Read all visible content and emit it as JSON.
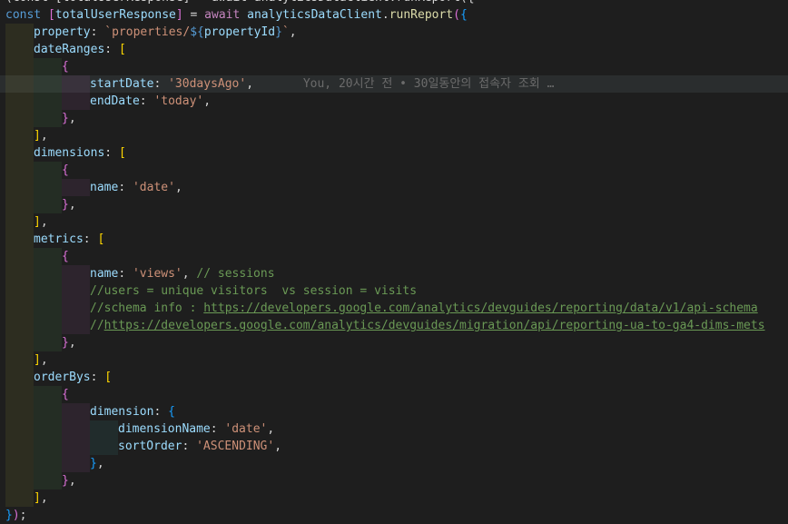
{
  "editor": {
    "colors": {
      "background": "#1e1e1e",
      "keyword": "#569cd6",
      "control": "#c586c0",
      "variable": "#9cdcfe",
      "function": "#dcdcaa",
      "string": "#ce9178",
      "comment": "#6a9955",
      "bracket_gold": "#ffd700",
      "bracket_orchid": "#da70d6",
      "bracket_blue": "#179fff"
    },
    "lines": [
      {
        "indent": 0,
        "tokens": [
          {
            "t": "(const [totalUserResponse] = await analyticsDataClient.runReport({",
            "c": "tk-p"
          }
        ]
      },
      {
        "indent": 0,
        "tokens": [
          {
            "t": "const ",
            "c": "tk-kw"
          },
          {
            "t": "[",
            "c": "tk-b2"
          },
          {
            "t": "totalUserResponse",
            "c": "tk-var"
          },
          {
            "t": "]",
            "c": "tk-b2"
          },
          {
            "t": " = ",
            "c": "tk-p"
          },
          {
            "t": "await ",
            "c": "tk-kw2"
          },
          {
            "t": "analyticsDataClient",
            "c": "tk-var"
          },
          {
            "t": ".",
            "c": "tk-p"
          },
          {
            "t": "runReport",
            "c": "tk-fn"
          },
          {
            "t": "(",
            "c": "tk-b2"
          },
          {
            "t": "{",
            "c": "tk-b3"
          }
        ]
      },
      {
        "indent": 1,
        "tokens": [
          {
            "t": "property",
            "c": "tk-var"
          },
          {
            "t": ": ",
            "c": "tk-p"
          },
          {
            "t": "`properties/",
            "c": "tk-str"
          },
          {
            "t": "${",
            "c": "tk-kw"
          },
          {
            "t": "propertyId",
            "c": "tk-var"
          },
          {
            "t": "}",
            "c": "tk-kw"
          },
          {
            "t": "`",
            "c": "tk-str"
          },
          {
            "t": ",",
            "c": "tk-p"
          }
        ]
      },
      {
        "indent": 1,
        "tokens": [
          {
            "t": "dateRanges",
            "c": "tk-var"
          },
          {
            "t": ": ",
            "c": "tk-p"
          },
          {
            "t": "[",
            "c": "tk-b1"
          }
        ]
      },
      {
        "indent": 2,
        "tokens": [
          {
            "t": "{",
            "c": "tk-b2"
          }
        ]
      },
      {
        "indent": 3,
        "current": true,
        "tokens": [
          {
            "t": "startDate",
            "c": "tk-var"
          },
          {
            "t": ": ",
            "c": "tk-p"
          },
          {
            "t": "'30daysAgo'",
            "c": "tk-str"
          },
          {
            "t": ",",
            "c": "tk-p"
          },
          {
            "t": "       You, 20시간 전 • 30일동안의 접속자 조회 …",
            "c": "ghost"
          }
        ]
      },
      {
        "indent": 3,
        "tokens": [
          {
            "t": "endDate",
            "c": "tk-var"
          },
          {
            "t": ": ",
            "c": "tk-p"
          },
          {
            "t": "'today'",
            "c": "tk-str"
          },
          {
            "t": ",",
            "c": "tk-p"
          }
        ]
      },
      {
        "indent": 2,
        "tokens": [
          {
            "t": "}",
            "c": "tk-b2"
          },
          {
            "t": ",",
            "c": "tk-p"
          }
        ]
      },
      {
        "indent": 1,
        "tokens": [
          {
            "t": "]",
            "c": "tk-b1"
          },
          {
            "t": ",",
            "c": "tk-p"
          }
        ]
      },
      {
        "indent": 1,
        "tokens": [
          {
            "t": "dimensions",
            "c": "tk-var"
          },
          {
            "t": ": ",
            "c": "tk-p"
          },
          {
            "t": "[",
            "c": "tk-b1"
          }
        ]
      },
      {
        "indent": 2,
        "tokens": [
          {
            "t": "{",
            "c": "tk-b2"
          }
        ]
      },
      {
        "indent": 3,
        "tokens": [
          {
            "t": "name",
            "c": "tk-var"
          },
          {
            "t": ": ",
            "c": "tk-p"
          },
          {
            "t": "'date'",
            "c": "tk-str"
          },
          {
            "t": ",",
            "c": "tk-p"
          }
        ]
      },
      {
        "indent": 2,
        "tokens": [
          {
            "t": "}",
            "c": "tk-b2"
          },
          {
            "t": ",",
            "c": "tk-p"
          }
        ]
      },
      {
        "indent": 1,
        "tokens": [
          {
            "t": "]",
            "c": "tk-b1"
          },
          {
            "t": ",",
            "c": "tk-p"
          }
        ]
      },
      {
        "indent": 1,
        "tokens": [
          {
            "t": "metrics",
            "c": "tk-var"
          },
          {
            "t": ": ",
            "c": "tk-p"
          },
          {
            "t": "[",
            "c": "tk-b1"
          }
        ]
      },
      {
        "indent": 2,
        "tokens": [
          {
            "t": "{",
            "c": "tk-b2"
          }
        ]
      },
      {
        "indent": 3,
        "tokens": [
          {
            "t": "name",
            "c": "tk-var"
          },
          {
            "t": ": ",
            "c": "tk-p"
          },
          {
            "t": "'views'",
            "c": "tk-str"
          },
          {
            "t": ", ",
            "c": "tk-p"
          },
          {
            "t": "// sessions",
            "c": "tk-cmt"
          }
        ]
      },
      {
        "indent": 3,
        "tokens": [
          {
            "t": "//users = unique visitors  vs session = visits",
            "c": "tk-cmt"
          }
        ]
      },
      {
        "indent": 3,
        "tokens": [
          {
            "t": "//schema info : ",
            "c": "tk-cmt"
          },
          {
            "t": "https://developers.google.com/analytics/devguides/reporting/data/v1/api-schema",
            "c": "tk-url"
          }
        ]
      },
      {
        "indent": 3,
        "tokens": [
          {
            "t": "//",
            "c": "tk-cmt"
          },
          {
            "t": "https://developers.google.com/analytics/devguides/migration/api/reporting-ua-to-ga4-dims-mets",
            "c": "tk-url"
          }
        ]
      },
      {
        "indent": 2,
        "tokens": [
          {
            "t": "}",
            "c": "tk-b2"
          },
          {
            "t": ",",
            "c": "tk-p"
          }
        ]
      },
      {
        "indent": 1,
        "tokens": [
          {
            "t": "]",
            "c": "tk-b1"
          },
          {
            "t": ",",
            "c": "tk-p"
          }
        ]
      },
      {
        "indent": 1,
        "tokens": [
          {
            "t": "orderBys",
            "c": "tk-var"
          },
          {
            "t": ": ",
            "c": "tk-p"
          },
          {
            "t": "[",
            "c": "tk-b1"
          }
        ]
      },
      {
        "indent": 2,
        "tokens": [
          {
            "t": "{",
            "c": "tk-b2"
          }
        ]
      },
      {
        "indent": 3,
        "tokens": [
          {
            "t": "dimension",
            "c": "tk-var"
          },
          {
            "t": ": ",
            "c": "tk-p"
          },
          {
            "t": "{",
            "c": "tk-b3"
          }
        ]
      },
      {
        "indent": 4,
        "tokens": [
          {
            "t": "dimensionName",
            "c": "tk-var"
          },
          {
            "t": ": ",
            "c": "tk-p"
          },
          {
            "t": "'date'",
            "c": "tk-str"
          },
          {
            "t": ",",
            "c": "tk-p"
          }
        ]
      },
      {
        "indent": 4,
        "tokens": [
          {
            "t": "sortOrder",
            "c": "tk-var"
          },
          {
            "t": ": ",
            "c": "tk-p"
          },
          {
            "t": "'ASCENDING'",
            "c": "tk-str"
          },
          {
            "t": ",",
            "c": "tk-p"
          }
        ]
      },
      {
        "indent": 3,
        "tokens": [
          {
            "t": "}",
            "c": "tk-b3"
          },
          {
            "t": ",",
            "c": "tk-p"
          }
        ]
      },
      {
        "indent": 2,
        "tokens": [
          {
            "t": "}",
            "c": "tk-b2"
          },
          {
            "t": ",",
            "c": "tk-p"
          }
        ]
      },
      {
        "indent": 1,
        "tokens": [
          {
            "t": "]",
            "c": "tk-b1"
          },
          {
            "t": ",",
            "c": "tk-p"
          }
        ]
      },
      {
        "indent": 0,
        "tokens": [
          {
            "t": "}",
            "c": "tk-b3"
          },
          {
            "t": ")",
            "c": "tk-b2"
          },
          {
            "t": ";",
            "c": "tk-p"
          }
        ]
      }
    ]
  }
}
